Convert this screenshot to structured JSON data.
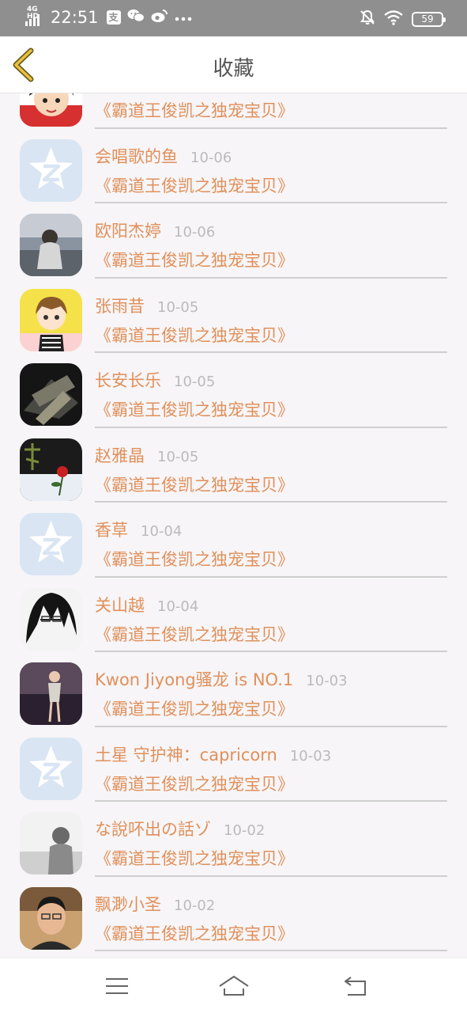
{
  "status_bar": {
    "network": "4G HD",
    "time": "22:51",
    "app_icons": [
      "alipay-icon",
      "wechat-icon",
      "weibo-icon",
      "more-dots-icon"
    ],
    "battery": "59"
  },
  "header": {
    "title": "收藏",
    "back_icon": "chevron-left-icon",
    "accent": "#e0905b"
  },
  "favorites": [
    {
      "name": "",
      "date": "",
      "link": "《霸道王俊凯之独宠宝贝》",
      "avatar": "cartoon-boy"
    },
    {
      "name": "会唱歌的鱼",
      "date": "10-06",
      "link": "《霸道王俊凯之独宠宝贝》",
      "avatar": "qzone-default"
    },
    {
      "name": "欧阳杰婷",
      "date": "10-06",
      "link": "《霸道王俊凯之独宠宝贝》",
      "avatar": "photo-girl"
    },
    {
      "name": "张雨昔",
      "date": "10-05",
      "link": "《霸道王俊凯之独宠宝贝》",
      "avatar": "cartoon-girl"
    },
    {
      "name": "长安长乐",
      "date": "10-05",
      "link": "《霸道王俊凯之独宠宝贝》",
      "avatar": "dark-photo"
    },
    {
      "name": "赵雅晶",
      "date": "10-05",
      "link": "《霸道王俊凯之独宠宝贝》",
      "avatar": "rose"
    },
    {
      "name": "香草",
      "date": "10-04",
      "link": "《霸道王俊凯之独宠宝贝》",
      "avatar": "qzone-default"
    },
    {
      "name": "关山越",
      "date": "10-04",
      "link": "《霸道王俊凯之独宠宝贝》",
      "avatar": "anime-boy"
    },
    {
      "name": "Kwon Jiyong骚龙 is NO.1",
      "date": "10-03",
      "link": "《霸道王俊凯之独宠宝贝》",
      "avatar": "photo-woman"
    },
    {
      "name": "土星 守护神：capricorn",
      "date": "10-03",
      "link": "《霸道王俊凯之独宠宝贝》",
      "avatar": "qzone-default"
    },
    {
      "name": "な說吥出の話ゾ",
      "date": "10-02",
      "link": "《霸道王俊凯之独宠宝贝》",
      "avatar": "bw-photo"
    },
    {
      "name": "飘渺小圣",
      "date": "10-02",
      "link": "《霸道王俊凯之独宠宝贝》",
      "avatar": "photo-man"
    }
  ],
  "bottom_nav": [
    "menu-icon",
    "home-icon",
    "return-icon"
  ]
}
